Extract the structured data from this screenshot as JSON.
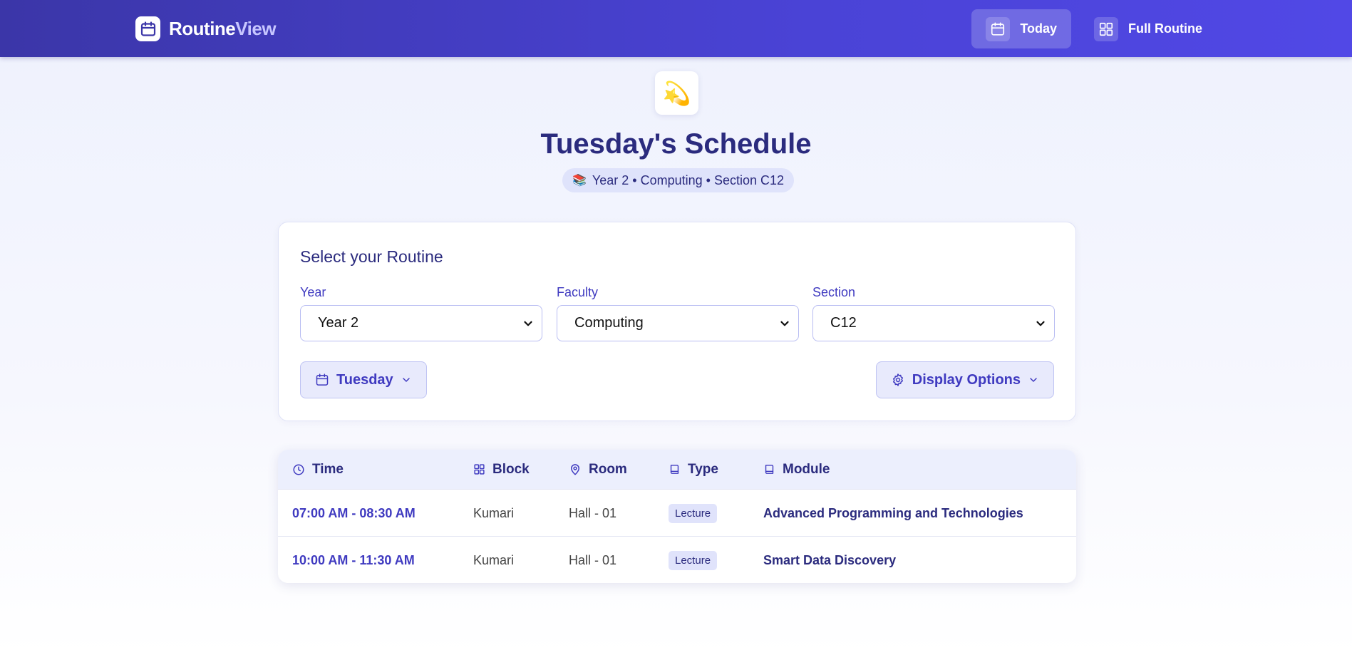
{
  "header": {
    "brand_part1": "Routine",
    "brand_part2": "View",
    "nav": [
      {
        "label": "Today",
        "icon": "calendar-icon",
        "active": true
      },
      {
        "label": "Full Routine",
        "icon": "grid-icon",
        "active": false
      }
    ]
  },
  "hero": {
    "title": "Tuesday's Schedule",
    "context": "Year 2 • Computing • Section C12",
    "emoji": "💫",
    "context_emoji": "📚"
  },
  "selector": {
    "title": "Select your Routine",
    "year": {
      "label": "Year",
      "value": "Year 2"
    },
    "faculty": {
      "label": "Faculty",
      "value": "Computing"
    },
    "section": {
      "label": "Section",
      "value": "C12"
    },
    "day_button": "Tuesday",
    "display_options": "Display Options"
  },
  "table": {
    "headers": {
      "time": "Time",
      "block": "Block",
      "room": "Room",
      "type": "Type",
      "module": "Module"
    },
    "rows": [
      {
        "time": "07:00 AM - 08:30 AM",
        "block": "Kumari",
        "room": "Hall - 01",
        "type": "Lecture",
        "module": "Advanced Programming and Technologies"
      },
      {
        "time": "10:00 AM - 11:30 AM",
        "block": "Kumari",
        "room": "Hall - 01",
        "type": "Lecture",
        "module": "Smart Data Discovery"
      }
    ]
  },
  "colors": {
    "header_start": "#3b36a8",
    "header_end": "#5148e6",
    "accent": "#3f3ac0",
    "heading": "#2b2b7e"
  }
}
